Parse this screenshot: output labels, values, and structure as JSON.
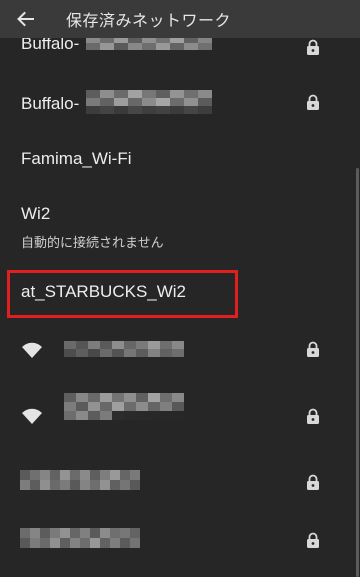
{
  "header": {
    "title": "保存済みネットワーク",
    "back_icon": "arrow-back-icon"
  },
  "networks": [
    {
      "name": "Buffalo-",
      "secured": true
    },
    {
      "name": "Buffalo-",
      "secured": true
    },
    {
      "name": "Famima_Wi-Fi",
      "secured": false
    },
    {
      "name": "Wi2",
      "status": "自動的に接続されません",
      "secured": false
    },
    {
      "name": "at_STARBUCKS_Wi2",
      "secured": false,
      "highlighted": true
    },
    {
      "name": "",
      "secured": true,
      "wifi_icon": true
    },
    {
      "name": "",
      "secured": true,
      "wifi_icon": true
    },
    {
      "name": "",
      "secured": true
    },
    {
      "name": "",
      "secured": true
    }
  ],
  "colors": {
    "background": "#262626",
    "app_bar": "#3a3a3a",
    "highlight_border": "#e21f1f"
  }
}
